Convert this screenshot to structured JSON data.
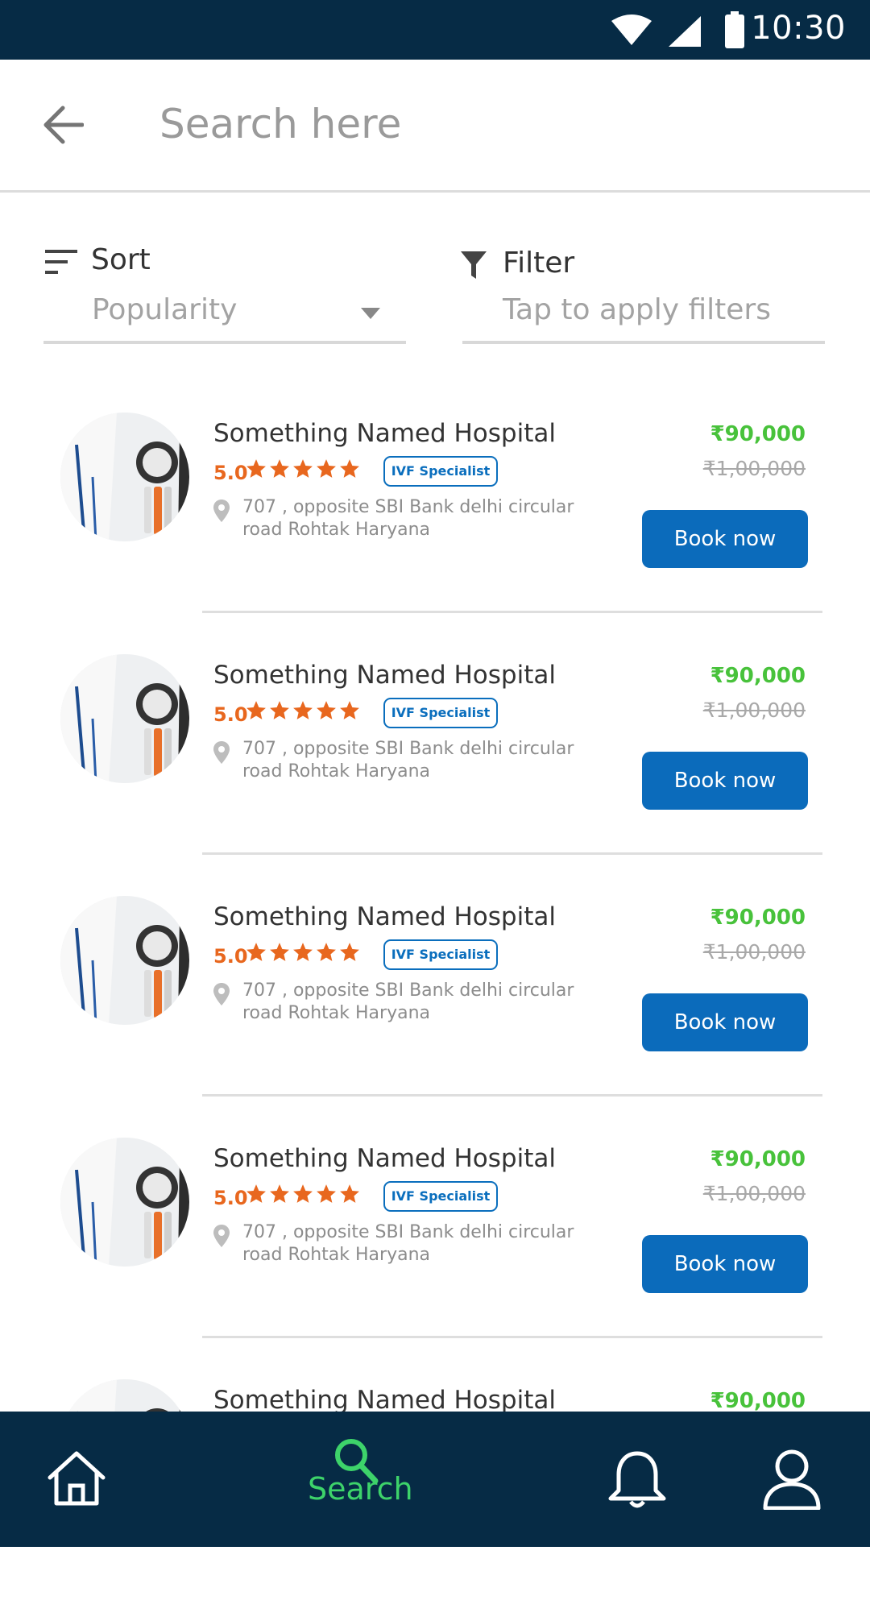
{
  "status_bar": {
    "time": "10:30",
    "icons": [
      "wifi-icon",
      "signal-icon",
      "battery-icon"
    ]
  },
  "search": {
    "placeholder": "Search here",
    "back_icon": "arrow-left-icon"
  },
  "sort": {
    "label": "Sort",
    "value": "Popularity",
    "icon": "sort-icon"
  },
  "filter": {
    "label": "Filter",
    "placeholder": "Tap to apply filters",
    "icon": "funnel-icon"
  },
  "results": [
    {
      "name": "Something Named Hospital",
      "rating": "5.0",
      "stars": 5,
      "badge": "IVF Specialist",
      "address": "707 , opposite SBI Bank delhi circular road Rohtak Haryana",
      "price": "₹90,000",
      "old_price": "₹1,00,000",
      "button": "Book now"
    },
    {
      "name": "Something Named Hospital",
      "rating": "5.0",
      "stars": 5,
      "badge": "IVF Specialist",
      "address": "707 , opposite SBI Bank delhi circular road Rohtak Haryana",
      "price": "₹90,000",
      "old_price": "₹1,00,000",
      "button": "Book now"
    },
    {
      "name": "Something Named Hospital",
      "rating": "5.0",
      "stars": 5,
      "badge": "IVF Specialist",
      "address": "707 , opposite SBI Bank delhi circular road Rohtak Haryana",
      "price": "₹90,000",
      "old_price": "₹1,00,000",
      "button": "Book now"
    },
    {
      "name": "Something Named Hospital",
      "rating": "5.0",
      "stars": 5,
      "badge": "IVF Specialist",
      "address": "707 , opposite SBI Bank delhi circular road Rohtak Haryana",
      "price": "₹90,000",
      "old_price": "₹1,00,000",
      "button": "Book now"
    },
    {
      "name": "Something Named Hospital",
      "price": "₹90,000"
    }
  ],
  "bottom_nav": {
    "items": [
      {
        "icon": "home-icon"
      },
      {
        "icon": "search-icon",
        "label": "Search",
        "active": true
      },
      {
        "icon": "bell-icon"
      },
      {
        "icon": "user-icon"
      }
    ]
  },
  "colors": {
    "header": "#062b45",
    "accent": "#0b6bbb",
    "price": "#48c23b",
    "rating": "#e8671e",
    "active_nav": "#3dd36a"
  }
}
